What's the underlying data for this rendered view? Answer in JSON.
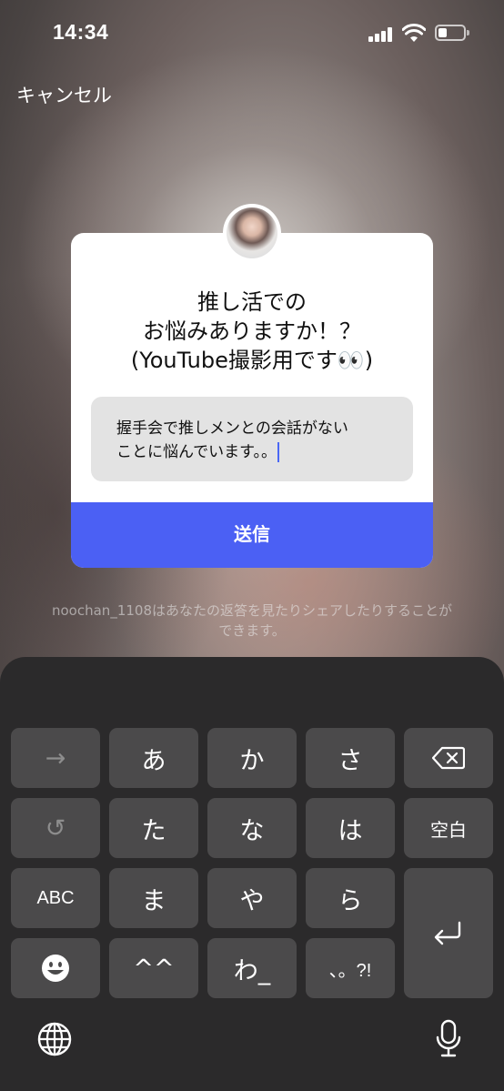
{
  "status_bar": {
    "time": "14:34"
  },
  "header": {
    "cancel_label": "キャンセル"
  },
  "question_card": {
    "question_line1": "推し活での",
    "question_line2": "お悩みありますか！？",
    "question_line3": "(YouTube撮影用です👀)",
    "answer_line1": "握手会で推しメンとの会話がない",
    "answer_line2": "ことに悩んでいます。。",
    "send_label": "送信"
  },
  "notice": {
    "line1": "noochan_1108はあなたの返答を見たりシェアしたりすることが",
    "line2": "できます。"
  },
  "keyboard": {
    "row1": [
      "→",
      "あ",
      "か",
      "さ"
    ],
    "row2": [
      "↺",
      "た",
      "な",
      "は",
      "空白"
    ],
    "row3": [
      "ABC",
      "ま",
      "や",
      "ら"
    ],
    "row4": [
      "☻",
      "^^",
      "わ_",
      "、。?!"
    ],
    "icons": {
      "delete": "delete-icon",
      "return": "return-icon",
      "globe": "globe-icon",
      "mic": "microphone-icon"
    }
  },
  "colors": {
    "send_button": "#4b60f4",
    "keyboard_bg": "#2b2a2b",
    "key_bg": "#4b4a4b",
    "caret": "#4a67f5"
  }
}
